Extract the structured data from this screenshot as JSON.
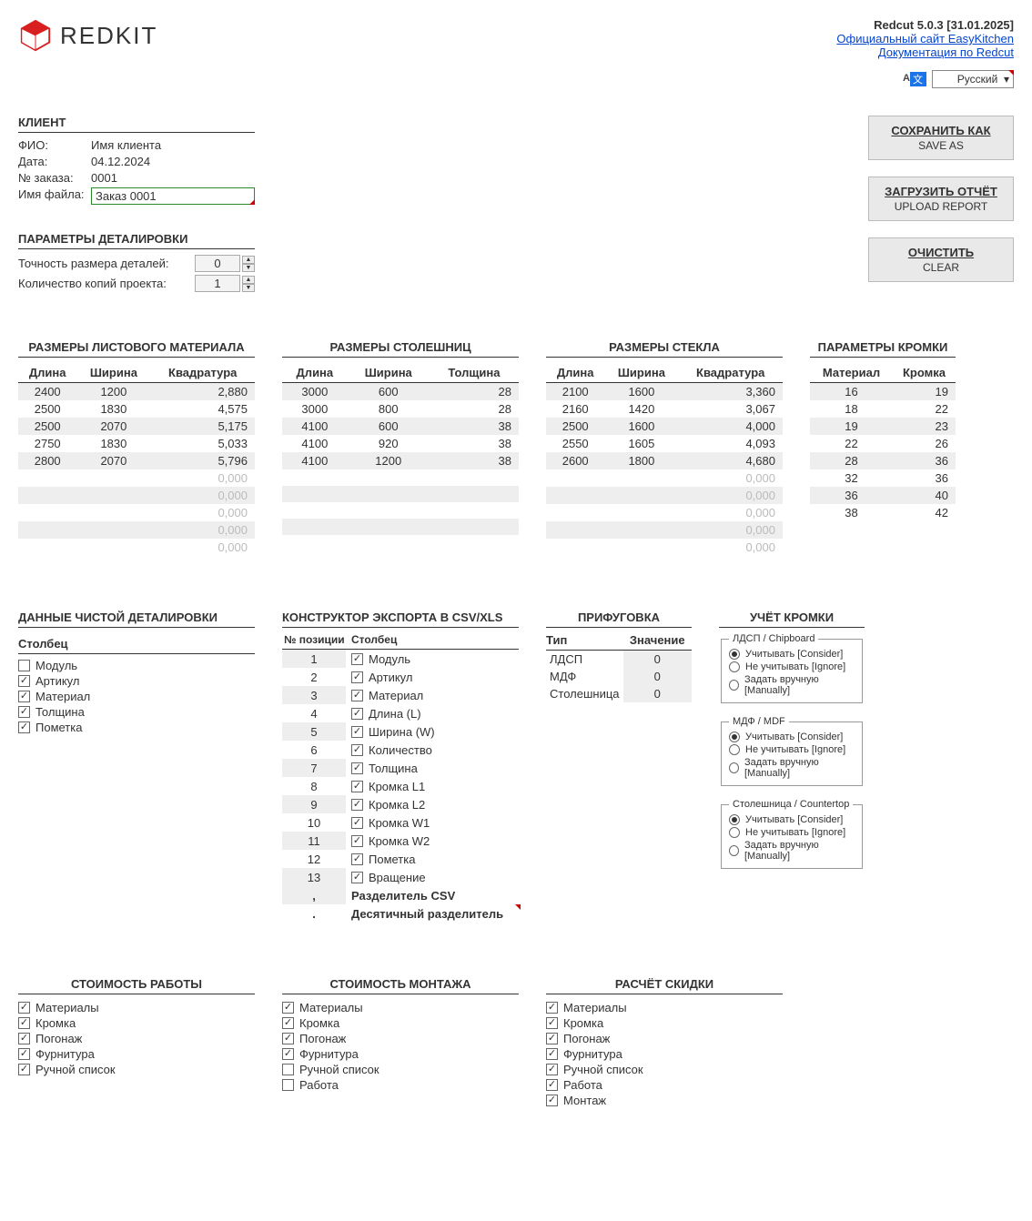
{
  "header": {
    "logo_text": "REDKIT",
    "version": "Redcut 5.0.3 [31.01.2025]",
    "link1": "Официальный сайт EasyKitchen",
    "link2": "Документация по Redcut",
    "lang": "Русский"
  },
  "client": {
    "title": "КЛИЕНТ",
    "fio_label": "ФИО:",
    "fio": "Имя клиента",
    "date_label": "Дата:",
    "date": "04.12.2024",
    "order_label": "№ заказа:",
    "order": "0001",
    "file_label": "Имя файла:",
    "file": "Заказ 0001"
  },
  "buttons": {
    "save_ru": "СОХРАНИТЬ КАК",
    "save_en": "SAVE AS",
    "upload_ru": "ЗАГРУЗИТЬ ОТЧЁТ",
    "upload_en": "UPLOAD REPORT",
    "clear_ru": "ОЧИСТИТЬ",
    "clear_en": "CLEAR"
  },
  "params": {
    "title": "ПАРАМЕТРЫ ДЕТАЛИРОВКИ",
    "precision_label": "Точность размера деталей:",
    "precision": "0",
    "copies_label": "Количество копий проекта:",
    "copies": "1"
  },
  "sheet": {
    "title": "РАЗМЕРЫ ЛИСТОВОГО МАТЕРИАЛА",
    "cols": [
      "Длина",
      "Ширина",
      "Квадратура"
    ],
    "rows": [
      [
        "2400",
        "1200",
        "2,880"
      ],
      [
        "2500",
        "1830",
        "4,575"
      ],
      [
        "2500",
        "2070",
        "5,175"
      ],
      [
        "2750",
        "1830",
        "5,033"
      ],
      [
        "2800",
        "2070",
        "5,796"
      ]
    ],
    "empty_q": [
      "0,000",
      "0,000",
      "0,000",
      "0,000",
      "0,000"
    ]
  },
  "countertop": {
    "title": "РАЗМЕРЫ СТОЛЕШНИЦ",
    "cols": [
      "Длина",
      "Ширина",
      "Толщина"
    ],
    "rows": [
      [
        "3000",
        "600",
        "28"
      ],
      [
        "3000",
        "800",
        "28"
      ],
      [
        "4100",
        "600",
        "38"
      ],
      [
        "4100",
        "920",
        "38"
      ],
      [
        "4100",
        "1200",
        "38"
      ]
    ]
  },
  "glass": {
    "title": "РАЗМЕРЫ СТЕКЛА",
    "cols": [
      "Длина",
      "Ширина",
      "Квадратура"
    ],
    "rows": [
      [
        "2100",
        "1600",
        "3,360"
      ],
      [
        "2160",
        "1420",
        "3,067"
      ],
      [
        "2500",
        "1600",
        "4,000"
      ],
      [
        "2550",
        "1605",
        "4,093"
      ],
      [
        "2600",
        "1800",
        "4,680"
      ]
    ],
    "empty_q": [
      "0,000",
      "0,000",
      "0,000",
      "0,000",
      "0,000"
    ]
  },
  "edge_params": {
    "title": "ПАРАМЕТРЫ КРОМКИ",
    "cols": [
      "Материал",
      "Кромка"
    ],
    "rows": [
      [
        "16",
        "19"
      ],
      [
        "18",
        "22"
      ],
      [
        "19",
        "23"
      ],
      [
        "22",
        "26"
      ],
      [
        "28",
        "36"
      ],
      [
        "32",
        "36"
      ],
      [
        "36",
        "40"
      ],
      [
        "38",
        "42"
      ]
    ]
  },
  "clean": {
    "title": "ДАННЫЕ ЧИСТОЙ ДЕТАЛИРОВКИ",
    "col_label": "Столбец",
    "items": [
      {
        "label": "Модуль",
        "checked": false
      },
      {
        "label": "Артикул",
        "checked": true
      },
      {
        "label": "Материал",
        "checked": true
      },
      {
        "label": "Толщина",
        "checked": true
      },
      {
        "label": "Пометка",
        "checked": true
      }
    ]
  },
  "export": {
    "title": "КОНСТРУКТОР ЭКСПОРТА В CSV/XLS",
    "pos_label": "№ позиции",
    "col_label": "Столбец",
    "rows": [
      {
        "pos": "1",
        "label": "Модуль",
        "checked": true
      },
      {
        "pos": "2",
        "label": "Артикул",
        "checked": true
      },
      {
        "pos": "3",
        "label": "Материал",
        "checked": true
      },
      {
        "pos": "4",
        "label": "Длина (L)",
        "checked": true
      },
      {
        "pos": "5",
        "label": "Ширина (W)",
        "checked": true
      },
      {
        "pos": "6",
        "label": "Количество",
        "checked": true
      },
      {
        "pos": "7",
        "label": "Толщина",
        "checked": true
      },
      {
        "pos": "8",
        "label": "Кромка L1",
        "checked": true
      },
      {
        "pos": "9",
        "label": "Кромка L2",
        "checked": true
      },
      {
        "pos": "10",
        "label": "Кромка W1",
        "checked": true
      },
      {
        "pos": "11",
        "label": "Кромка W2",
        "checked": true
      },
      {
        "pos": "12",
        "label": "Пометка",
        "checked": true
      },
      {
        "pos": "13",
        "label": "Вращение",
        "checked": true
      }
    ],
    "sep_csv_pos": ",",
    "sep_csv_label": "Разделитель CSV",
    "dec_sep_pos": ".",
    "dec_sep_label": "Десятичный разделитель"
  },
  "prif": {
    "title": "ПРИФУГОВКА",
    "type_label": "Тип",
    "val_label": "Значение",
    "rows": [
      {
        "type": "ЛДСП",
        "val": "0"
      },
      {
        "type": "МДФ",
        "val": "0"
      },
      {
        "type": "Столешница",
        "val": "0"
      }
    ]
  },
  "edge_calc": {
    "title": "УЧЁТ КРОМКИ",
    "groups": [
      {
        "legend": "ЛДСП / Chipboard",
        "opts": [
          "Учитывать [Consider]",
          "Не учитывать [Ignore]",
          "Задать вручную [Manually]"
        ],
        "sel": 0
      },
      {
        "legend": "МДФ / MDF",
        "opts": [
          "Учитывать [Consider]",
          "Не учитывать [Ignore]",
          "Задать вручную [Manually]"
        ],
        "sel": 0
      },
      {
        "legend": "Столешница / Countertop",
        "opts": [
          "Учитывать [Consider]",
          "Не учитывать [Ignore]",
          "Задать вручную [Manually]"
        ],
        "sel": 0
      }
    ]
  },
  "cost_work": {
    "title": "СТОИМОСТЬ РАБОТЫ",
    "items": [
      {
        "label": "Материалы",
        "checked": true
      },
      {
        "label": "Кромка",
        "checked": true
      },
      {
        "label": "Погонаж",
        "checked": true
      },
      {
        "label": "Фурнитура",
        "checked": true
      },
      {
        "label": "Ручной список",
        "checked": true
      }
    ]
  },
  "cost_install": {
    "title": "СТОИМОСТЬ МОНТАЖА",
    "items": [
      {
        "label": "Материалы",
        "checked": true
      },
      {
        "label": "Кромка",
        "checked": true
      },
      {
        "label": "Погонаж",
        "checked": true
      },
      {
        "label": "Фурнитура",
        "checked": true
      },
      {
        "label": "Ручной список",
        "checked": false
      },
      {
        "label": "Работа",
        "checked": false
      }
    ]
  },
  "discount": {
    "title": "РАСЧЁТ СКИДКИ",
    "items": [
      {
        "label": "Материалы",
        "checked": true
      },
      {
        "label": "Кромка",
        "checked": true
      },
      {
        "label": "Погонаж",
        "checked": true
      },
      {
        "label": "Фурнитура",
        "checked": true
      },
      {
        "label": "Ручной список",
        "checked": true
      },
      {
        "label": "Работа",
        "checked": true
      },
      {
        "label": "Монтаж",
        "checked": true
      }
    ]
  }
}
